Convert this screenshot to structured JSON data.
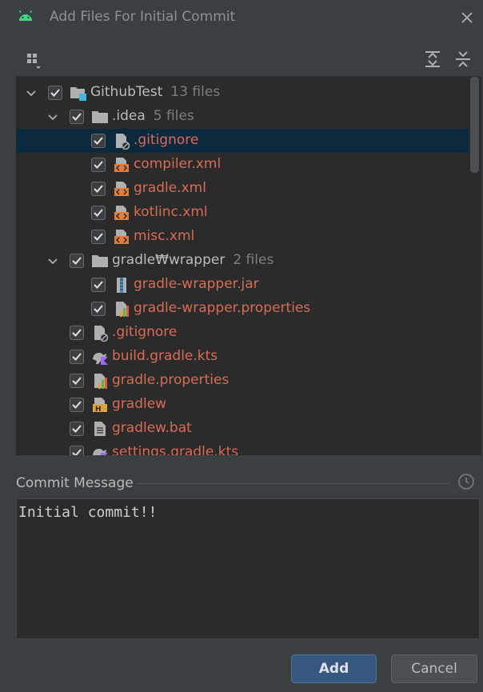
{
  "window": {
    "title": "Add Files For Initial Commit",
    "app_icon": "android-icon",
    "close_icon": "close-icon"
  },
  "toolbar": {
    "group_by_icon": "group-by-icon",
    "expand_all_icon": "expand-all-icon",
    "collapse_all_icon": "collapse-all-icon"
  },
  "tree": {
    "rows": [
      {
        "name": "GithubTest",
        "count": "13 files",
        "kind": "dir",
        "icon": "module-folder-icon",
        "level": 0,
        "expanded": true,
        "checked": true,
        "selected": false
      },
      {
        "name": ".idea",
        "count": "5 files",
        "kind": "dir",
        "icon": "folder-icon",
        "level": 1,
        "expanded": true,
        "checked": true,
        "selected": false
      },
      {
        "name": ".gitignore",
        "count": "",
        "kind": "file",
        "icon": "ignore-file-icon",
        "level": 2,
        "checked": true,
        "selected": true
      },
      {
        "name": "compiler.xml",
        "count": "",
        "kind": "file",
        "icon": "xml-file-icon",
        "level": 2,
        "checked": true,
        "selected": false
      },
      {
        "name": "gradle.xml",
        "count": "",
        "kind": "file",
        "icon": "xml-file-icon",
        "level": 2,
        "checked": true,
        "selected": false
      },
      {
        "name": "kotlinc.xml",
        "count": "",
        "kind": "file",
        "icon": "xml-file-icon",
        "level": 2,
        "checked": true,
        "selected": false
      },
      {
        "name": "misc.xml",
        "count": "",
        "kind": "file",
        "icon": "xml-file-icon",
        "level": 2,
        "checked": true,
        "selected": false
      },
      {
        "name": "gradle₩wrapper",
        "count": "2 files",
        "kind": "dir",
        "icon": "folder-icon",
        "level": 1,
        "expanded": true,
        "checked": true,
        "selected": false
      },
      {
        "name": "gradle-wrapper.jar",
        "count": "",
        "kind": "file",
        "icon": "jar-file-icon",
        "level": 2,
        "checked": true,
        "selected": false
      },
      {
        "name": "gradle-wrapper.properties",
        "count": "",
        "kind": "file",
        "icon": "properties-file-icon",
        "level": 2,
        "checked": true,
        "selected": false
      },
      {
        "name": ".gitignore",
        "count": "",
        "kind": "file",
        "icon": "ignore-file-icon",
        "level": 1,
        "checked": true,
        "selected": false
      },
      {
        "name": "build.gradle.kts",
        "count": "",
        "kind": "file",
        "icon": "gradle-kotlin-file-icon",
        "level": 1,
        "checked": true,
        "selected": false
      },
      {
        "name": "gradle.properties",
        "count": "",
        "kind": "file",
        "icon": "properties-file-icon",
        "level": 1,
        "checked": true,
        "selected": false
      },
      {
        "name": "gradlew",
        "count": "",
        "kind": "file",
        "icon": "shell-script-file-icon",
        "level": 1,
        "checked": true,
        "selected": false
      },
      {
        "name": "gradlew.bat",
        "count": "",
        "kind": "file",
        "icon": "text-file-icon",
        "level": 1,
        "checked": true,
        "selected": false
      },
      {
        "name": "settings.gradle.kts",
        "count": "",
        "kind": "file",
        "icon": "gradle-kotlin-file-icon",
        "level": 1,
        "checked": true,
        "selected": false
      }
    ]
  },
  "commit": {
    "label": "Commit Message",
    "message": "Initial commit!!",
    "history_icon": "history-icon"
  },
  "buttons": {
    "add": "Add",
    "cancel": "Cancel"
  },
  "colors": {
    "background": "#3c3f41",
    "tree_background": "#2b2b2b",
    "selection": "#0d293e",
    "new_file_text": "#d96b57",
    "primary_button": "#365880"
  }
}
